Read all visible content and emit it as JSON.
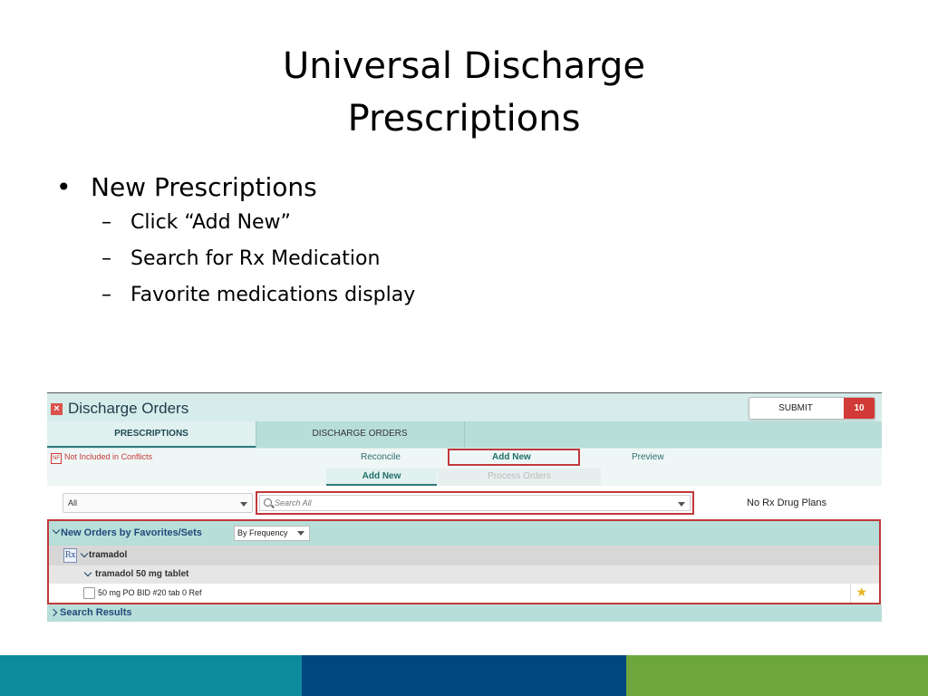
{
  "slide": {
    "title_line1": "Universal Discharge",
    "title_line2": "Prescriptions",
    "bullet": "New Prescriptions",
    "sub_bullets": [
      "Click “Add New”",
      "Search for Rx Medication",
      "Favorite medications display"
    ]
  },
  "app": {
    "title": "Discharge Orders",
    "submit_label": "SUBMIT",
    "submit_count": "10",
    "tabs": [
      "PRESCRIPTIONS",
      "DISCHARGE ORDERS"
    ],
    "conflict_text": "Not Included in Conflicts",
    "nf_icon": "NF",
    "subnav_links": [
      "Reconcile",
      "Add New",
      "Preview"
    ],
    "subtabs": [
      "Add New",
      "Process Orders"
    ],
    "type_filter": "All",
    "search_placeholder": "Search All",
    "drug_plans": "No Rx Drug Plans",
    "favorites_title": "New Orders by Favorites/Sets",
    "sort_select": "By Frequency",
    "drug_name": "tramadol",
    "drug_form": "tramadol 50 mg tablet",
    "dose_line": "50 mg PO BID #20 tab 0 Ref",
    "search_results": "Search Results",
    "rx_icon": "Rx"
  },
  "colors": {
    "band_left": "#0d8a9c",
    "band_mid": "#00477f",
    "band_right": "#6ca63d",
    "highlight": "#c0393b"
  }
}
